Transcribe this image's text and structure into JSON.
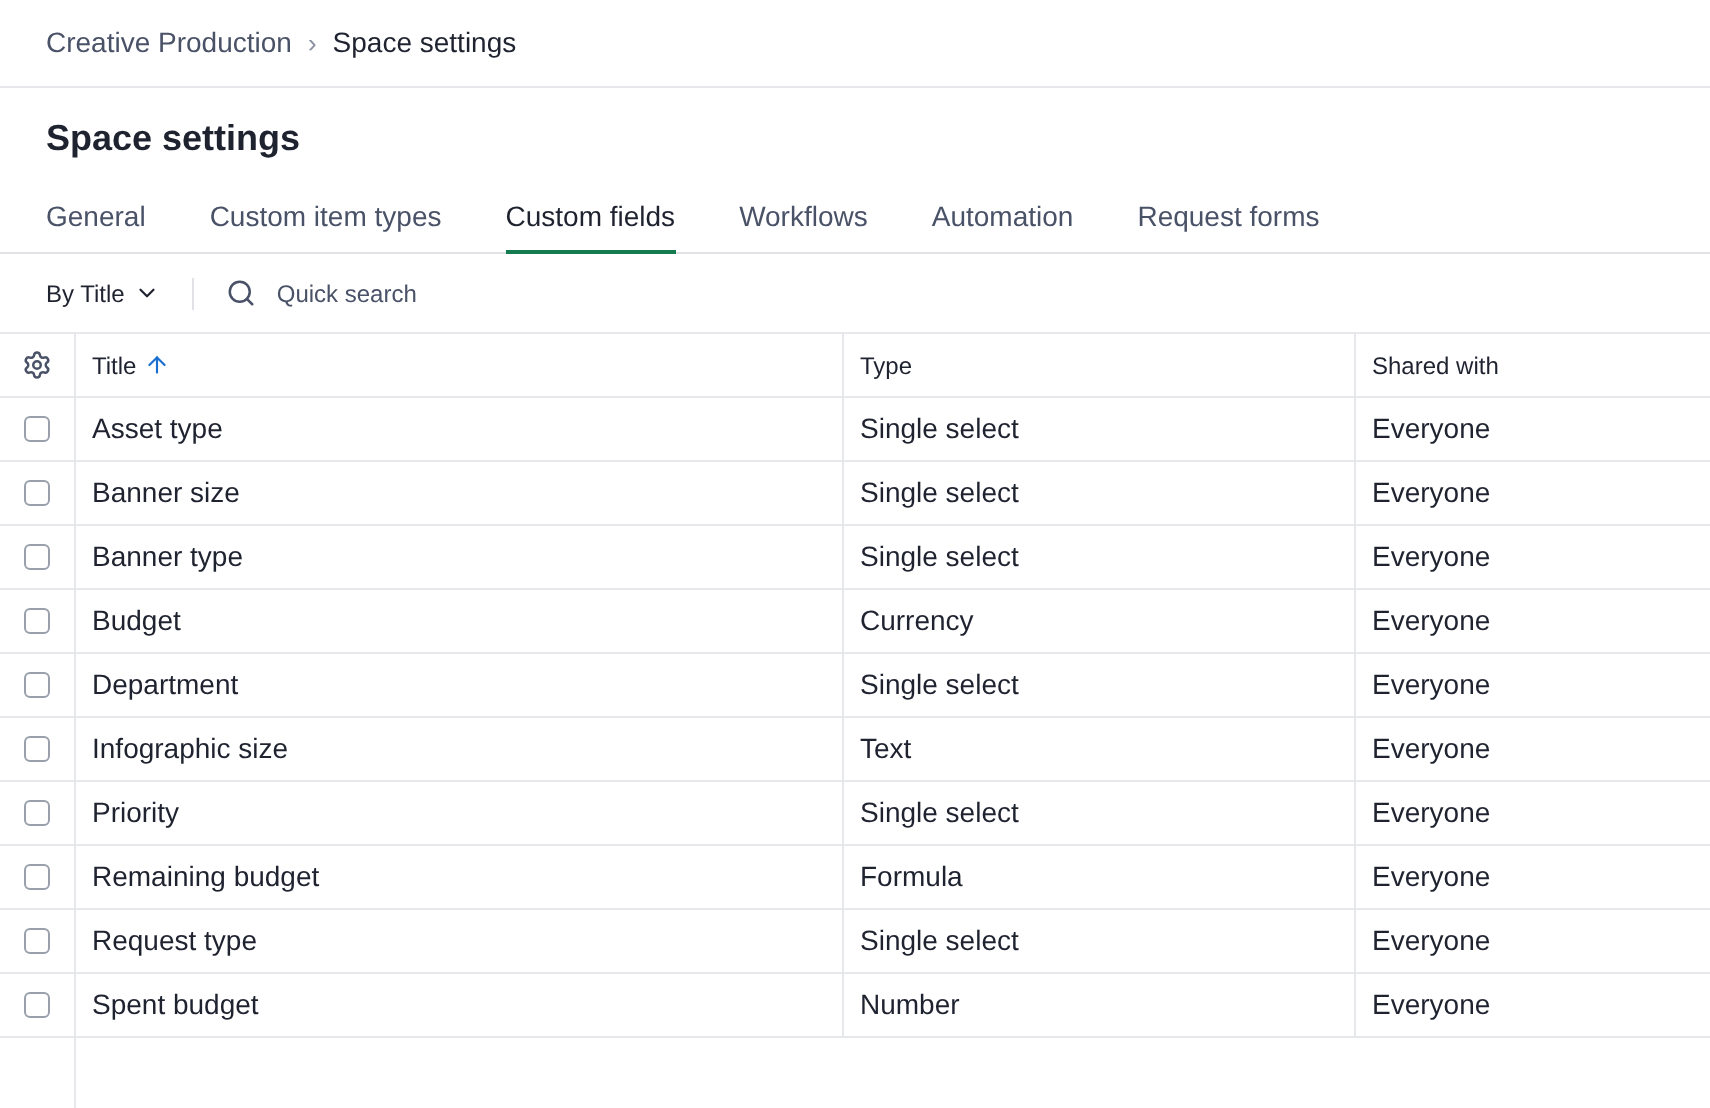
{
  "breadcrumb": {
    "parent": "Creative Production",
    "separator": "›",
    "current": "Space settings"
  },
  "title": "Space settings",
  "tabs": [
    {
      "label": "General",
      "selected": false
    },
    {
      "label": "Custom item types",
      "selected": false
    },
    {
      "label": "Custom fields",
      "selected": true
    },
    {
      "label": "Workflows",
      "selected": false
    },
    {
      "label": "Automation",
      "selected": false
    },
    {
      "label": "Request forms",
      "selected": false
    }
  ],
  "toolbar": {
    "sort": "By Title",
    "search": {
      "placeholder": "Quick search"
    }
  },
  "table": {
    "columns": [
      {
        "label": "Title",
        "sorted": true
      },
      {
        "label": "Type",
        "sorted": false
      },
      {
        "label": "Shared with",
        "sorted": false
      }
    ],
    "rows": [
      {
        "checked": false,
        "cells": [
          "Asset type",
          "Single select",
          "Everyone"
        ]
      },
      {
        "checked": false,
        "cells": [
          "Banner size",
          "Single select",
          "Everyone"
        ]
      },
      {
        "checked": false,
        "cells": [
          "Banner type",
          "Single select",
          "Everyone"
        ]
      },
      {
        "checked": false,
        "cells": [
          "Budget",
          "Currency",
          "Everyone"
        ]
      },
      {
        "checked": false,
        "cells": [
          "Department",
          "Single select",
          "Everyone"
        ]
      },
      {
        "checked": false,
        "cells": [
          "Infographic size",
          "Text",
          "Everyone"
        ]
      },
      {
        "checked": false,
        "cells": [
          "Priority",
          "Single select",
          "Everyone"
        ]
      },
      {
        "checked": false,
        "cells": [
          "Remaining budget",
          "Formula",
          "Everyone"
        ]
      },
      {
        "checked": false,
        "cells": [
          "Request type",
          "Single select",
          "Everyone"
        ]
      },
      {
        "checked": false,
        "cells": [
          "Spent budget",
          "Number",
          "Everyone"
        ]
      }
    ]
  }
}
